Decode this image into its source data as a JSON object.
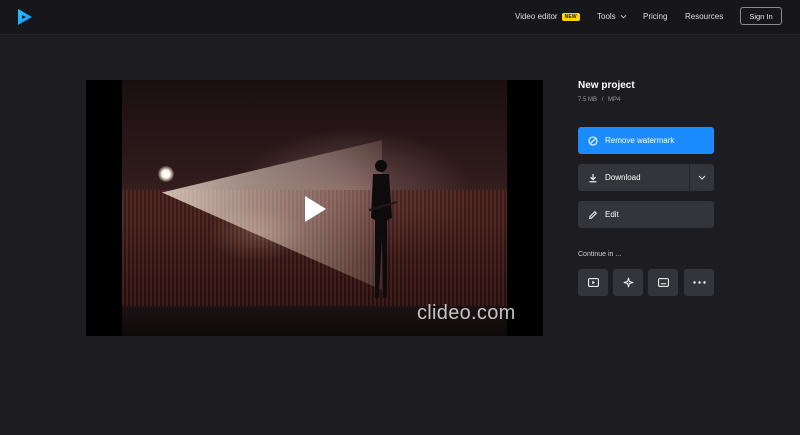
{
  "header": {
    "logo": "clideo-play-logo",
    "nav": [
      {
        "label": "Video editor",
        "badge": "NEW"
      },
      {
        "label": "Tools"
      },
      {
        "label": "Pricing"
      },
      {
        "label": "Resources"
      }
    ],
    "sign_in": "Sign In"
  },
  "player": {
    "watermark": "clideo.com",
    "play_icon": "play-icon"
  },
  "project": {
    "title": "New project",
    "size": "7.5 MB",
    "separator": "/",
    "format": "MP4"
  },
  "actions": {
    "remove_watermark": "Remove watermark",
    "download": "Download",
    "edit": "Edit"
  },
  "continue": {
    "label": "Continue in ...",
    "tools": [
      "video-player-icon",
      "sparkle-icon",
      "subtitles-icon",
      "more-dots-icon"
    ]
  },
  "colors": {
    "background": "#1c1c21",
    "primary": "#1a8cff",
    "badge": "#ffd60a",
    "button_dark": "#34343b"
  }
}
